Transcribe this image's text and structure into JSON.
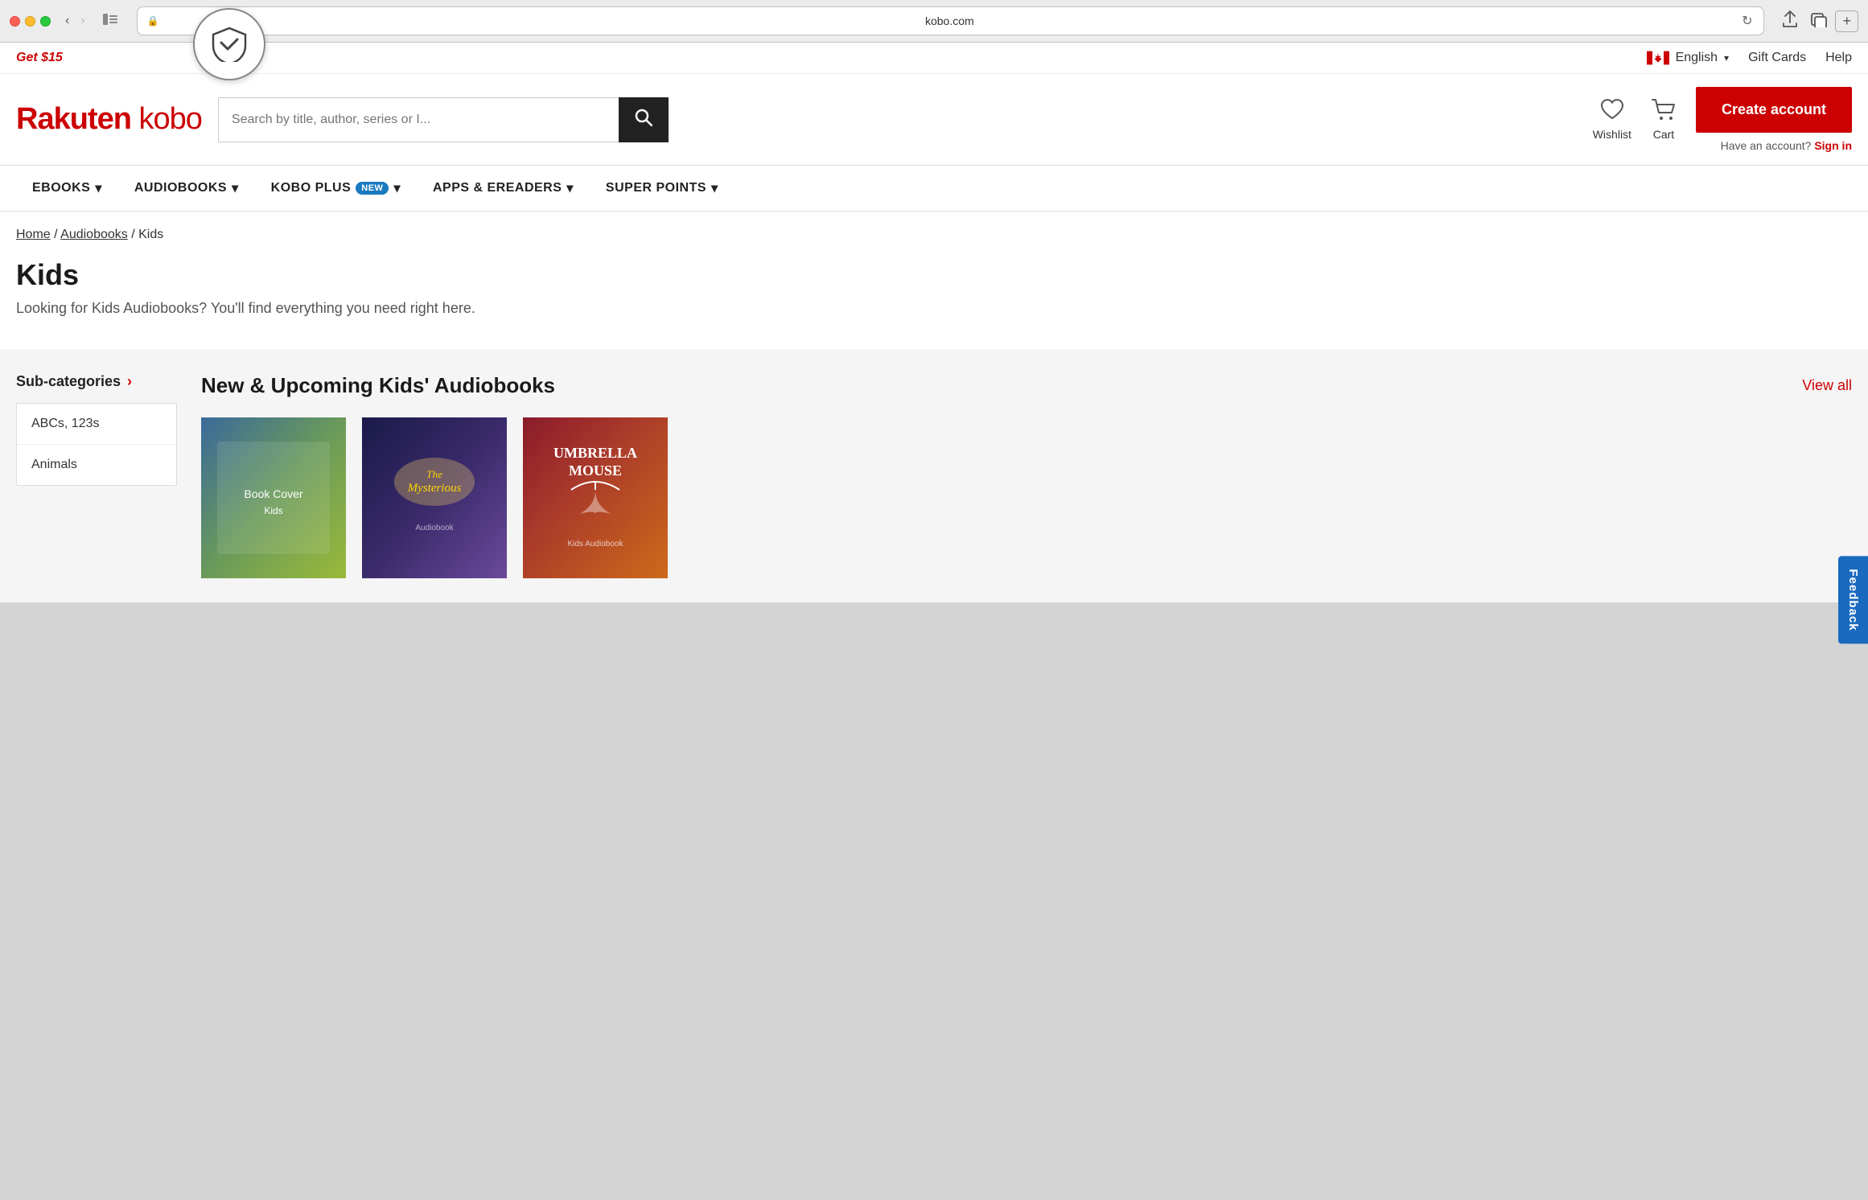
{
  "browser": {
    "url": "kobo.com",
    "url_display": "kobo.com",
    "back_disabled": false,
    "forward_disabled": true
  },
  "topbar": {
    "offer": "Get $15",
    "language": "English",
    "gift_cards": "Gift Cards",
    "help": "Help"
  },
  "header": {
    "logo": "Rakuten kobo",
    "search_placeholder": "Search by title, author, series or I...",
    "wishlist_label": "Wishlist",
    "cart_label": "Cart",
    "create_account_label": "Create account",
    "have_account_text": "Have an account?",
    "sign_in_label": "Sign in"
  },
  "nav": {
    "items": [
      {
        "label": "eBOOKS",
        "has_dropdown": true,
        "badge": null
      },
      {
        "label": "AUDIOBOOKS",
        "has_dropdown": true,
        "badge": null
      },
      {
        "label": "KOBO PLUS",
        "has_dropdown": true,
        "badge": "NEW"
      },
      {
        "label": "APPS & eREADERS",
        "has_dropdown": true,
        "badge": null
      },
      {
        "label": "SUPER POINTS",
        "has_dropdown": true,
        "badge": null
      }
    ]
  },
  "breadcrumb": {
    "items": [
      {
        "label": "Home",
        "link": true
      },
      {
        "label": "Audiobooks",
        "link": true
      },
      {
        "label": "Kids",
        "link": false
      }
    ]
  },
  "page": {
    "title": "Kids",
    "subtitle": "Looking for Kids Audiobooks? You'll find everything you need right here."
  },
  "sidebar": {
    "title": "Sub-categories",
    "categories": [
      {
        "label": "ABCs, 123s"
      },
      {
        "label": "Animals"
      }
    ]
  },
  "section": {
    "title": "New & Upcoming Kids' Audiobooks",
    "view_all": "View all",
    "books": [
      {
        "id": 1,
        "alt": "Book cover 1"
      },
      {
        "id": 2,
        "alt": "The Mysterious book cover"
      },
      {
        "id": 3,
        "alt": "Umbrella Mouse book cover"
      }
    ]
  },
  "feedback": {
    "label": "Feedback"
  }
}
